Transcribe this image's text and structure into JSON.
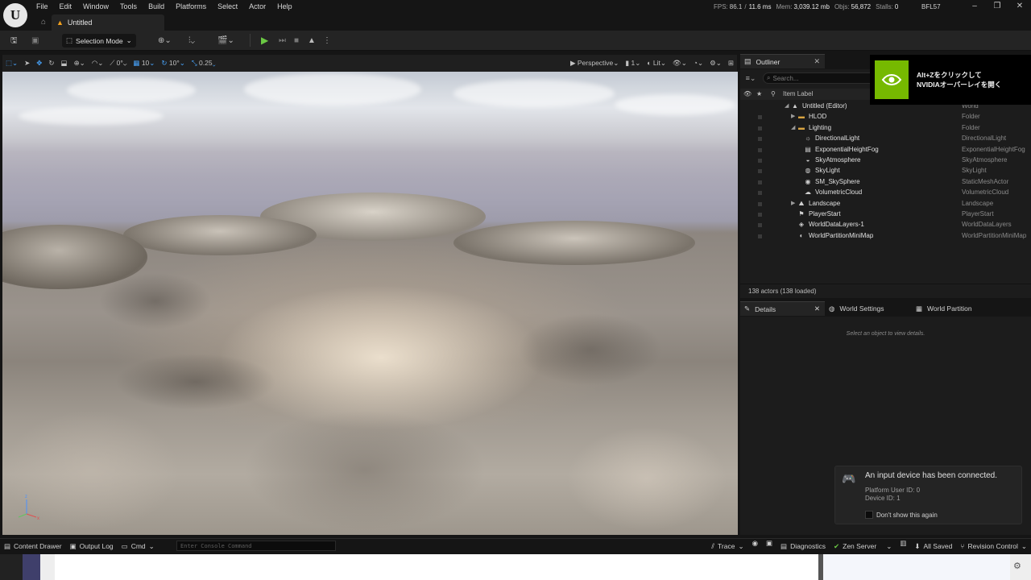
{
  "menu": [
    "File",
    "Edit",
    "Window",
    "Tools",
    "Build",
    "Platforms",
    "Select",
    "Actor",
    "Help"
  ],
  "level_tab": "Untitled",
  "stats": {
    "fps_label": "FPS:",
    "fps": "86.1",
    "ms": "11.6 ms",
    "mem_label": "Mem:",
    "mem": "3,039.12 mb",
    "objs_label": "Objs:",
    "objs": "56,872",
    "stalls_label": "Stalls:",
    "stalls": "0"
  },
  "project": "BFL57",
  "toolbar": {
    "selection_mode": "Selection Mode"
  },
  "viewport_toolbar": {
    "rot_snap": "0°",
    "grid_snap": "10",
    "angle_snap": "10°",
    "scale_snap": "0.25",
    "perspective": "Perspective",
    "camera_speed": "1",
    "lit": "Lit"
  },
  "outliner": {
    "tab": "Outliner",
    "search_placeholder": "Search...",
    "col_label": "Item Label",
    "col_type": "Type",
    "items": [
      {
        "label": "Untitled (Editor)",
        "type": "World"
      },
      {
        "label": "HLOD",
        "type": "Folder"
      },
      {
        "label": "Lighting",
        "type": "Folder"
      },
      {
        "label": "DirectionalLight",
        "type": "DirectionalLight"
      },
      {
        "label": "ExponentialHeightFog",
        "type": "ExponentialHeightFog"
      },
      {
        "label": "SkyAtmosphere",
        "type": "SkyAtmosphere"
      },
      {
        "label": "SkyLight",
        "type": "SkyLight"
      },
      {
        "label": "SM_SkySphere",
        "type": "StaticMeshActor"
      },
      {
        "label": "VolumetricCloud",
        "type": "VolumetricCloud"
      },
      {
        "label": "Landscape",
        "type": "Landscape"
      },
      {
        "label": "PlayerStart",
        "type": "PlayerStart"
      },
      {
        "label": "WorldDataLayers-1",
        "type": "WorldDataLayers"
      },
      {
        "label": "WorldPartitionMiniMap",
        "type": "WorldPartitionMiniMap"
      }
    ],
    "actors": "138 actors (138 loaded)"
  },
  "nvidia": {
    "line1": "Alt+Zをクリックして",
    "line2": "NVIDIAオーバーレイを開く"
  },
  "details": {
    "tabs": [
      "Details",
      "World Settings",
      "World Partition"
    ],
    "hint": "Select an object to view details."
  },
  "notification": {
    "title": "An input device has been connected.",
    "line1": "Platform User ID: 0",
    "line2": "Device ID: 1",
    "checkbox": "Don't show this again"
  },
  "statusbar": {
    "content_drawer": "Content Drawer",
    "output_log": "Output Log",
    "cmd": "Cmd",
    "cmd_placeholder": "Enter Console Command",
    "trace": "Trace",
    "diagnostics": "Diagnostics",
    "zen_server": "Zen Server",
    "all_saved": "All Saved",
    "revision_control": "Revision Control"
  },
  "colors": {
    "accent_blue": "#49a6ff",
    "play_green": "#6bc944",
    "folder": "#d9a441",
    "nvidia_green": "#76b900"
  }
}
